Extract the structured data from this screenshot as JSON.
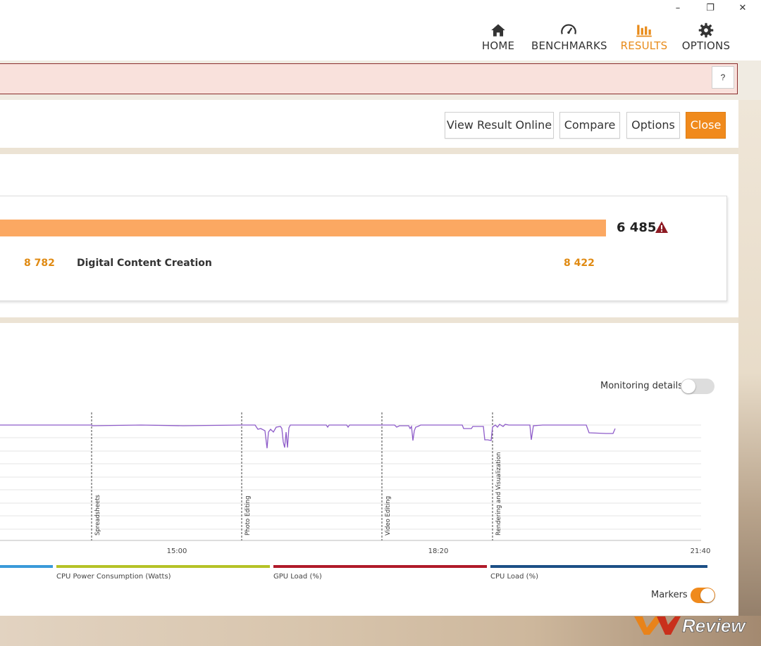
{
  "window": {
    "minimize": "–",
    "maximize": "❐",
    "close": "✕"
  },
  "nav": {
    "items": [
      {
        "label": "HOME",
        "icon": "home-icon",
        "active": false
      },
      {
        "label": "BENCHMARKS",
        "icon": "speedometer-icon",
        "active": false
      },
      {
        "label": "RESULTS",
        "icon": "bar-chart-icon",
        "active": true
      },
      {
        "label": "OPTIONS",
        "icon": "gear-icon",
        "active": false
      }
    ],
    "accent_color": "#e88b1a"
  },
  "warning": {
    "help_label": "?"
  },
  "actions": {
    "view_online": "View Result Online",
    "compare": "Compare",
    "options": "Options",
    "close": "Close"
  },
  "score": {
    "total": "6 485",
    "warning_icon": "warning-triangle-icon",
    "left_value": "8 782",
    "category_label": "Digital Content Creation",
    "category_value": "8 422"
  },
  "monitoring": {
    "details_label": "Monitoring details",
    "details_enabled": false,
    "markers_label": "Markers",
    "markers_enabled": true
  },
  "chart_data": {
    "type": "line",
    "x_ticks": [
      "15:00",
      "18:20",
      "21:40"
    ],
    "markers": [
      "Spreadsheets",
      "Photo Editing",
      "Video Editing",
      "Rendering and Visualization"
    ],
    "series_color": "#8e5cc9",
    "legend": [
      {
        "name": "",
        "color": "#3a9ad9"
      },
      {
        "name": "CPU Power Consumption (Watts)",
        "color": "#b5c227"
      },
      {
        "name": "GPU Load (%)",
        "color": "#b01a2a"
      },
      {
        "name": "CPU Load (%)",
        "color": "#1c4f86"
      }
    ]
  },
  "watermark": "VNReview"
}
